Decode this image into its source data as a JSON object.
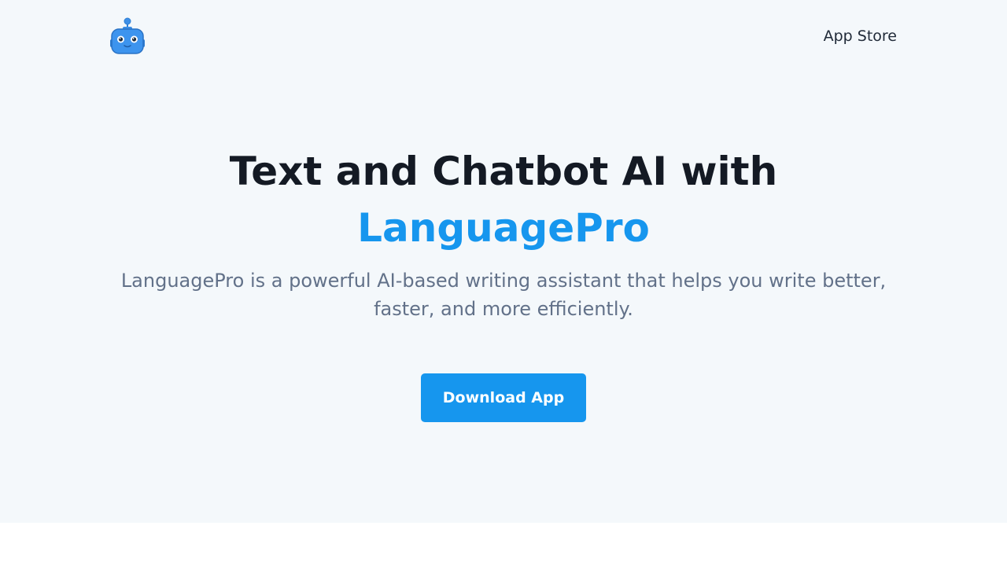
{
  "nav": {
    "logo_icon": "robot-icon",
    "app_store_label": "App Store"
  },
  "hero": {
    "headline_line1": "Text and Chatbot AI with",
    "headline_brand": "LanguagePro",
    "description": "LanguagePro is a powerful AI-based writing assistant that helps you write better, faster, and more efficiently.",
    "cta_label": "Download App"
  },
  "colors": {
    "accent": "#1696ee",
    "hero_background": "#f4f8fb",
    "heading_text": "#141a24",
    "body_text": "#627189"
  }
}
